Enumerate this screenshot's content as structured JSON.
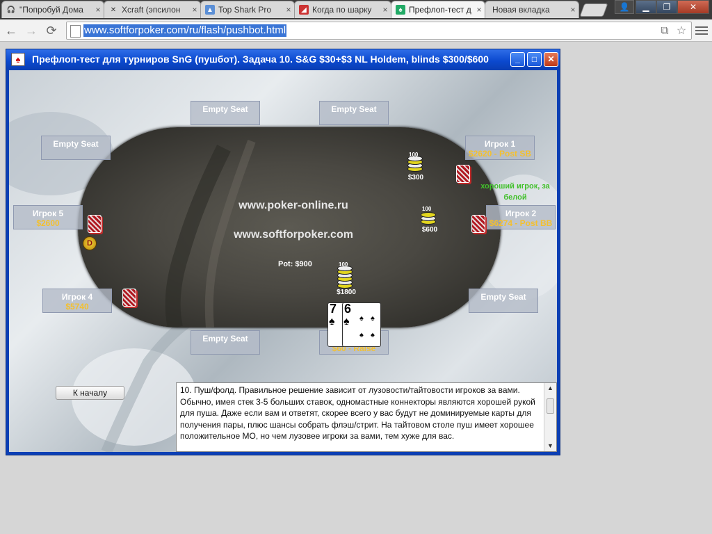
{
  "browser": {
    "tabs": [
      {
        "label": "\"Попробуй Дома",
        "favicon": "headphones-icon"
      },
      {
        "label": "Xcraft (эпсилон",
        "favicon": "crossed-swords-icon"
      },
      {
        "label": "Top Shark Pro",
        "favicon": "shark-icon"
      },
      {
        "label": "Когда по шарку",
        "favicon": "chart-icon"
      },
      {
        "label": "Префлоп-тест д",
        "favicon": "cards-icon"
      },
      {
        "label": "Новая вкладка",
        "favicon": ""
      }
    ],
    "close_glyph": "×",
    "url": "www.softforpoker.com/ru/flash/pushbot.html"
  },
  "app": {
    "title": "Префлоп-тест для турниров SnG (пушбот). Задача 10. S&G $30+$3 NL Holdem, blinds $300/$600",
    "site1": "www.poker-online.ru",
    "site2": "www.softforpoker.com",
    "pot": "Pot: $900",
    "seats": {
      "top_left": "Empty Seat",
      "top_right": "Empty Seat",
      "left_upper": "Empty Seat",
      "right_lower": "Empty Seat",
      "bottom_left": "Empty Seat",
      "player1": {
        "name": "Игрок 1",
        "stack": "$2620 - Post SB"
      },
      "player2": {
        "name": "Игрок 2",
        "stack": "$6274 - Post BB"
      },
      "player4": {
        "name": "Игрок 4",
        "stack": "$5740"
      },
      "player5": {
        "name": "Игрок 5",
        "stack": "$2600"
      },
      "hero": {
        "name": "ВЫ",
        "stack": "$60 - Raise"
      }
    },
    "bets": {
      "p1": "$300",
      "p2": "$600",
      "hero": "$1800"
    },
    "chip_value": "100",
    "dealer": "D",
    "hint": "хороший игрок, за белой",
    "hole_cards": [
      {
        "rank": "7",
        "suit": "♠"
      },
      {
        "rank": "6",
        "suit": "♠"
      }
    ],
    "back_button": "К началу",
    "explanation": "10. Пуш/фолд. Правильное решение зависит от лузовости/тайтовости игроков за вами. Обычно, имея стек 3-5 больших ставок, одномастные коннекторы являются хорошей рукой для пуша. Даже если вам и ответят, скорее всего у вас будут не доминируемые карты для получения пары, плюс шансы собрать флэш/стрит. На тайтовом столе пуш имеет хорошее положительное МО, но чем лузовее игроки за вами, тем хуже для вас."
  }
}
